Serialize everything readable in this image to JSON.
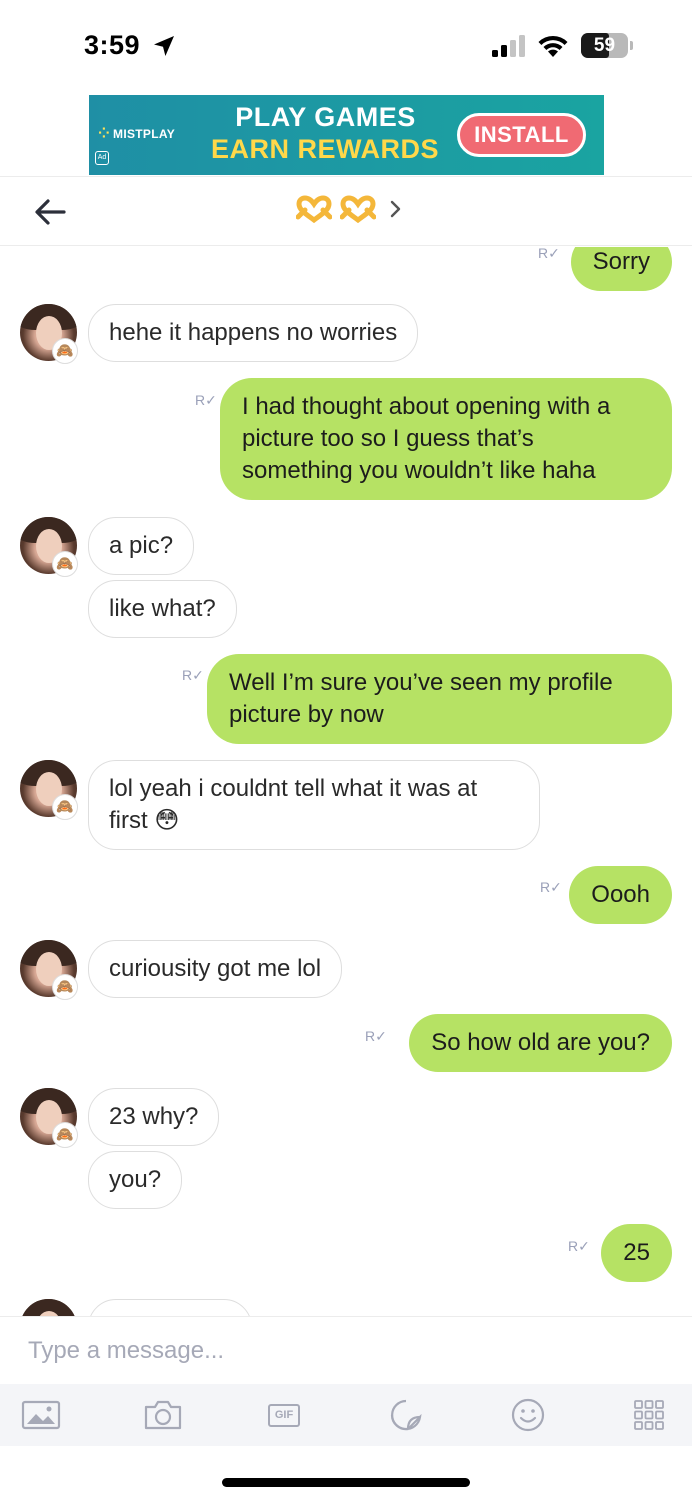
{
  "status_bar": {
    "time": "3:59",
    "battery_pct": "59",
    "battery_level": 0.59
  },
  "ad": {
    "brand": "MISTPLAY",
    "badge": "Ad",
    "line1": "PLAY GAMES",
    "line2": "EARN REWARDS",
    "install_label": "INSTALL"
  },
  "header": {
    "title_icons": [
      "heart-hands-icon",
      "heart-hands-icon"
    ]
  },
  "messages": [
    {
      "side": "sent",
      "text": "Sorry"
    },
    {
      "side": "received",
      "text": "hehe it happens no worries"
    },
    {
      "side": "sent",
      "text": "I had thought about opening with a picture too so I guess that’s something you wouldn’t like haha"
    },
    {
      "side": "received",
      "text": "a pic?"
    },
    {
      "side": "received",
      "text": "like what?"
    },
    {
      "side": "sent",
      "text": "Well I’m sure you’ve seen my profile picture by now"
    },
    {
      "side": "received",
      "text": "lol yeah i couldnt tell what it was at first 😳"
    },
    {
      "side": "sent",
      "text": "Oooh"
    },
    {
      "side": "received",
      "text": "curiousity got me lol"
    },
    {
      "side": "sent",
      "text": "So how old are you?"
    },
    {
      "side": "received",
      "text": "23 why?"
    },
    {
      "side": "received",
      "text": "you?"
    },
    {
      "side": "sent",
      "text": "25"
    }
  ],
  "read_receipt_glyph": "R",
  "avatar_badge_emoji": "🙈",
  "composer": {
    "placeholder": "Type a message..."
  },
  "toolbar": {
    "gif_label": "GIF",
    "icons": [
      "image-icon",
      "camera-icon",
      "gif-icon",
      "sticker-icon",
      "emoji-icon",
      "apps-grid-icon"
    ]
  },
  "colors": {
    "sent_bubble": "#b6e264",
    "received_border": "#dedede",
    "ad_bg": "#1aa4a1",
    "install_btn": "#f06a73",
    "ad_yellow": "#ffd84a",
    "icon_gray": "#a6a9b7"
  }
}
